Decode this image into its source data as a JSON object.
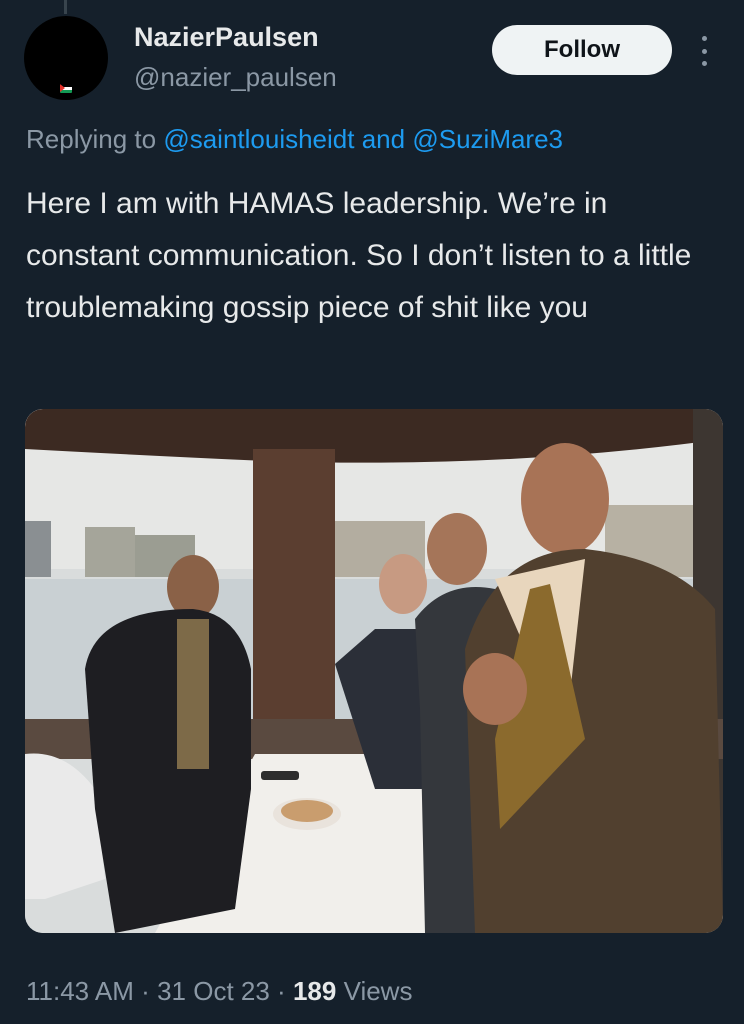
{
  "tweet": {
    "display_name": "NazierPaulsen",
    "handle": "@nazier_paulsen",
    "follow_label": "Follow",
    "replying_prefix": "Replying to",
    "mention_1": "@saintlouisheidt",
    "replying_and": "and",
    "mention_2": "@SuziMare3",
    "text": "Here I am with HAMAS leadership. We’re in constant communication. So I don’t listen to a little troublemaking gossip piece of shit like you",
    "time": "11:43 AM",
    "separator": "·",
    "date": "31 Oct 23",
    "views_count": "189",
    "views_label": "Views"
  },
  "colors": {
    "background": "#15202b",
    "text": "#e7e9ea",
    "muted": "#8b98a5",
    "link": "#1d9bf0",
    "button_bg": "#eff3f4"
  },
  "icons": {
    "more": "more-vertical-icon",
    "flag": "palestine-flag-icon"
  }
}
